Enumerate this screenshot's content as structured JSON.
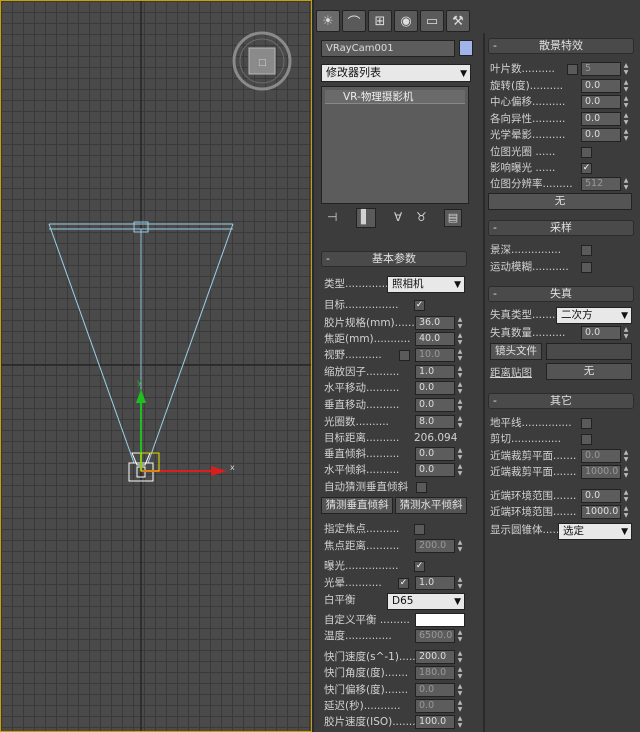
{
  "tabs": [
    {
      "icon": "sun-icon",
      "glyph": "☀",
      "active": true
    },
    {
      "icon": "curve-icon",
      "glyph": "⌒"
    },
    {
      "icon": "hierarchy-icon",
      "glyph": "⊞"
    },
    {
      "icon": "motion-icon",
      "glyph": "◉"
    },
    {
      "icon": "display-icon",
      "glyph": "▭"
    },
    {
      "icon": "utilities-icon",
      "glyph": "⚒"
    }
  ],
  "object_name": "VRayCam001",
  "modifier_list": "修改器列表",
  "modifier_stack": [
    "VR-物理摄影机"
  ],
  "basic_params": {
    "title": "基本参数",
    "type_label": "类型...............",
    "type_value": "照相机",
    "target_label": "目标................",
    "film_gate_label": "胶片规格(mm)...........",
    "film_gate": "36.0",
    "focal_length_label": "焦距(mm)...........",
    "focal_length": "40.0",
    "fov_label": "视野...........",
    "fov": "10.0",
    "zoom_label": "缩放因子..........",
    "zoom": "1.0",
    "hshift_label": "水平移动..........",
    "hshift": "0.0",
    "vshift_label": "垂直移动..........",
    "vshift": "0.0",
    "fnumber_label": "光圈数..........",
    "fnumber": "8.0",
    "target_distance_label": "目标距离..........",
    "target_distance": "206.094",
    "vtilt_label": "垂直倾斜..........",
    "vtilt": "0.0",
    "htilt_label": "水平倾斜..........",
    "htilt": "0.0",
    "auto_vtilt_label": "自动猜测垂直倾斜",
    "guess_vtilt_btn": "猜测垂直倾斜",
    "guess_htilt_btn": "猜测水平倾斜",
    "specify_focus_label": "指定焦点..........",
    "focus_distance_label": "焦点距离..........",
    "focus_distance": "200.0",
    "exposure_label": "曝光................",
    "vignetting_label": "光晕...........",
    "vignetting": "1.0",
    "white_balance_label": "白平衡",
    "white_balance": "D65",
    "custom_balance_label": "自定义平衡 .........",
    "temperature_label": "温度..............",
    "temperature": "6500.0",
    "shutter_speed_label": "快门速度(s^-1).......",
    "shutter_speed": "200.0",
    "shutter_angle_label": "快门角度(度).......",
    "shutter_angle": "180.0",
    "shutter_offset_label": "快门偏移(度).......",
    "shutter_offset": "0.0",
    "latency_label": "延迟(秒)...........",
    "latency": "0.0",
    "iso_label": "胶片速度(ISO).......",
    "iso": "100.0"
  },
  "bokeh": {
    "title": "散景特效",
    "blades_label": "叶片数..........",
    "blades": "5",
    "rotation_label": "旋转(度)..........",
    "rotation": "0.0",
    "center_bias_label": "中心偏移..........",
    "center_bias": "0.0",
    "anisotropy_label": "各向异性..........",
    "anisotropy": "0.0",
    "optical_vignetting_label": "光学晕影..........",
    "optical_vignetting": "0.0",
    "bitmap_aperture_label": "位图光圈 ......",
    "affect_exposure_label": "影响曝光 ......",
    "bitmap_resolution_label": "位图分辨率.........",
    "bitmap_resolution": "512",
    "none_button": "无"
  },
  "sampling": {
    "title": "采样",
    "dof_label": "景深...............",
    "motion_blur_label": "运动模糊..........."
  },
  "distortion": {
    "title": "失真",
    "type_label": "失真类型..........",
    "type_value": "二次方",
    "amount_label": "失真数量..........",
    "amount": "0.0",
    "lens_file_button": "镜头文件",
    "distortion_map_label": "距离贴图",
    "map_none_button": "无"
  },
  "misc": {
    "title": "其它",
    "horizon_label": "地平线...............",
    "clipping_label": "剪切...............",
    "near_clip_label": "近端裁剪平面.......",
    "near_clip": "0.0",
    "far_clip_label": "近端裁剪平面.......",
    "far_clip": "1000.0",
    "near_env_label": "近端环境范围.......",
    "near_env": "0.0",
    "far_env_label": "近端环境范围.......",
    "far_env": "1000.0",
    "show_cone_label": "显示圆锥体......",
    "show_cone_value": "选定"
  },
  "colors": {
    "swatch": "#9fb4e8",
    "grid_bg": "#4a4a4a",
    "viewport_border": "#c8a000"
  }
}
